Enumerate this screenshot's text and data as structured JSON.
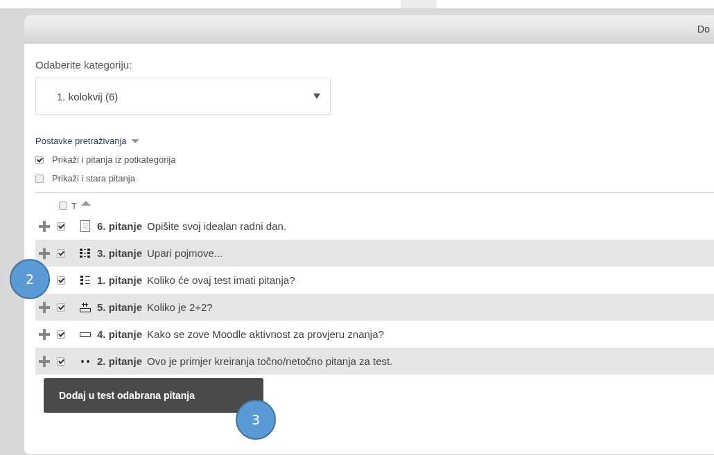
{
  "dialog": {
    "title": "Do"
  },
  "category": {
    "label": "Odaberite kategoriju:",
    "value": "1. kolokvij (6)"
  },
  "search_options": {
    "label": "Postavke pretraživanja",
    "options": [
      {
        "label": "Prikaži i pitanja iz potkategorija",
        "checked": true
      },
      {
        "label": "Prikaži i stara pitanja",
        "checked": false
      }
    ]
  },
  "table": {
    "select_all_checked": false,
    "type_column": "T",
    "questions": [
      {
        "kind": "essay",
        "checked": true,
        "name": "6. pitanje",
        "text": "Opišite svoj idealan radni dan."
      },
      {
        "kind": "matching",
        "checked": true,
        "name": "3. pitanje",
        "text": "Upari pojmove..."
      },
      {
        "kind": "multichoice",
        "checked": true,
        "name": "1. pitanje",
        "text": "Koliko će ovaj test imati pitanja?"
      },
      {
        "kind": "numerical",
        "checked": true,
        "name": "5. pitanje",
        "text": "Koliko je 2+2?"
      },
      {
        "kind": "shortanswer",
        "checked": true,
        "name": "4. pitanje",
        "text": "Kako se zove Moodle aktivnost za provjeru znanja?"
      },
      {
        "kind": "truefalse",
        "checked": true,
        "name": "2. pitanje",
        "text": "Ovo je primjer kreiranja točno/netočno pitanja za test."
      }
    ]
  },
  "add_button": "Dodaj u test odabrana pitanja",
  "callouts": [
    {
      "label": "2"
    },
    {
      "label": "3"
    }
  ]
}
